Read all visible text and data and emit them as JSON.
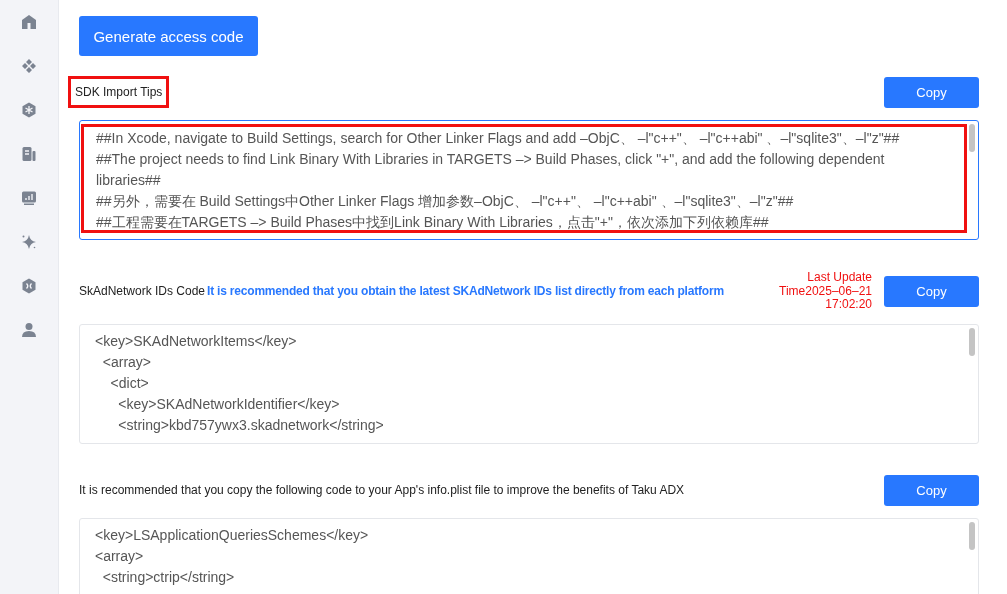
{
  "sidebar": {
    "items": [
      {
        "kind": "home",
        "selected": false
      },
      {
        "kind": "diamonds",
        "selected": false
      },
      {
        "kind": "snowflake",
        "selected": false
      },
      {
        "kind": "document",
        "selected": false
      },
      {
        "kind": "chart",
        "selected": false
      },
      {
        "kind": "sparkle",
        "selected": false
      },
      {
        "kind": "hexagon",
        "selected": false
      },
      {
        "kind": "user",
        "selected": false
      }
    ]
  },
  "generate_button": "Generate access code",
  "sections": [
    {
      "label": "SDK Import Tips",
      "label_highlighted": true,
      "copy_button": "Copy",
      "code_focused": true,
      "code_highlighted": true,
      "code_lines": [
        "##In Xcode, navigate to Build Settings, search for Other Linker Flags and add –ObjC、 –l\"c++\"、 –l\"c++abi\" 、–l\"sqlite3\"、–l\"z\"##",
        "##The project needs to find Link Binary With Libraries in TARGETS –> Build Phases, click \"+\", and add the following dependent libraries##",
        "##另外，需要在 Build Settings中Other Linker Flags 增加参数–ObjC、 –l\"c++\"、 –l\"c++abi\" 、–l\"sqlite3\"、–l\"z\"##",
        "##工程需要在TARGETS –> Build Phases中找到Link Binary With Libraries，点击\"+\"，依次添加下列依赖库##"
      ]
    },
    {
      "label": "SkAdNetwork IDs Code",
      "note": "It is recommended that you obtain the latest SKAdNetwork IDs list directly from each platform",
      "update_lines": [
        "Last Update",
        "Time2025–06–21",
        "17:02:20"
      ],
      "copy_button": "Copy",
      "code_focused": false,
      "code_lines": [
        "<key>SKAdNetworkItems</key>",
        "  <array>",
        "    <dict>",
        "      <key>SKAdNetworkIdentifier</key>",
        "      <string>kbd757ywx3.skadnetwork</string>"
      ]
    },
    {
      "label": "It is recommended that you copy the following code to your App's info.plist file to improve the benefits of Taku ADX",
      "copy_button": "Copy",
      "code_focused": false,
      "code_lines": [
        "<key>LSApplicationQueriesSchemes</key>",
        "<array>",
        "  <string>ctrip</string>"
      ]
    }
  ]
}
